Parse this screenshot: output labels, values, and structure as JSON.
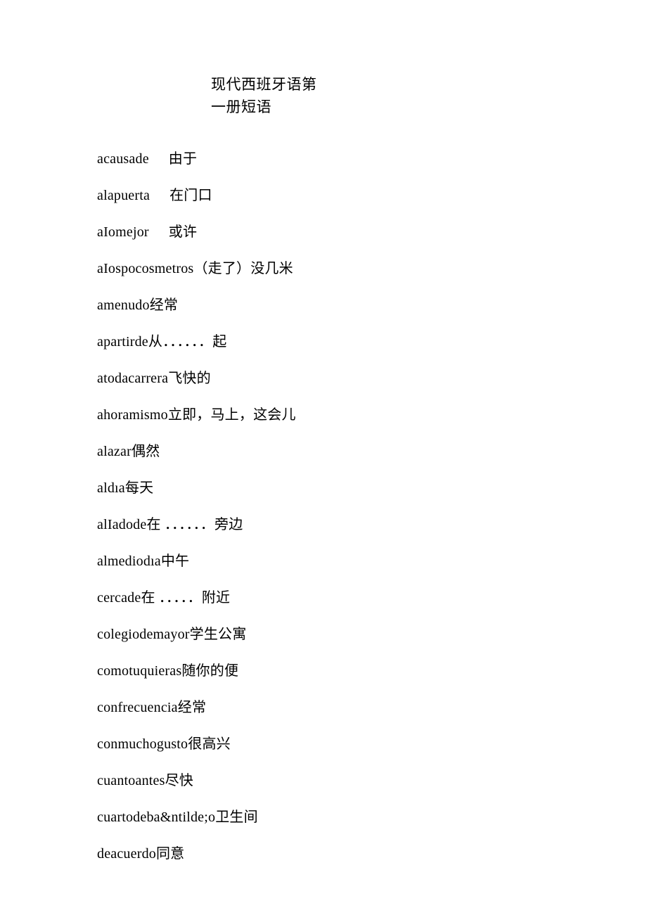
{
  "title": {
    "line1": "现代西班牙语第",
    "line2": "一册短语"
  },
  "entries": [
    {
      "term": "acausade",
      "gap": "wide",
      "def": "由于"
    },
    {
      "term": "alapuerta",
      "gap": "wide",
      "def": "在门口"
    },
    {
      "term": "aIomejor",
      "gap": "wide",
      "def": "或许"
    },
    {
      "term": "aIospocosmetros",
      "gap": "none",
      "def": "（走了）没几米"
    },
    {
      "term": "amenudo",
      "gap": "none",
      "def": "经常"
    },
    {
      "term": "apartirde",
      "gap": "none",
      "def": "从．．．．．．起"
    },
    {
      "term": "atodacarrera",
      "gap": "none",
      "def": "飞快的"
    },
    {
      "term": "ahoramismo",
      "gap": "none",
      "def": "立即，马上，这会儿"
    },
    {
      "term": "alazar",
      "gap": "none",
      "def": "偶然"
    },
    {
      "term": "aldıa",
      "gap": "none",
      "def": "每天"
    },
    {
      "term": "alIadode",
      "gap": "none",
      "def": "在 ．．．．．．旁边"
    },
    {
      "term": "almediodıa",
      "gap": "none",
      "def": "中午"
    },
    {
      "term": "cercade",
      "gap": "none",
      "def": "在 ．．．．．附近"
    },
    {
      "term": "colegiodemayor",
      "gap": "none",
      "def": "学生公寓"
    },
    {
      "term": "comotuquieras",
      "gap": "none",
      "def": "随你的便"
    },
    {
      "term": "confrecuencia",
      "gap": "none",
      "def": "经常"
    },
    {
      "term": "conmuchogusto",
      "gap": "none",
      "def": "很高兴"
    },
    {
      "term": "cuantoantes",
      "gap": "none",
      "def": "尽快"
    },
    {
      "term": "cuartodeba&ntilde;o",
      "gap": "none",
      "def": "卫生间"
    },
    {
      "term": "deacuerdo",
      "gap": "none",
      "def": "同意"
    }
  ]
}
